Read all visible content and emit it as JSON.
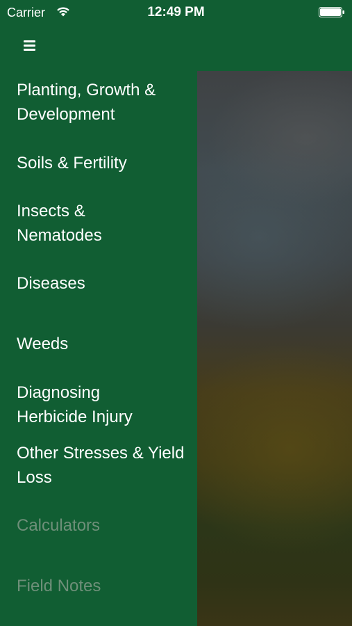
{
  "status_bar": {
    "carrier": "Carrier",
    "time": "12:49 PM",
    "wifi_icon": "wifi-icon",
    "battery_icon": "battery-icon"
  },
  "nav": {
    "menu_icon": "hamburger-menu-icon"
  },
  "menu": {
    "items": [
      {
        "label": "Planting, Growth & Development",
        "enabled": true
      },
      {
        "label": "Soils & Fertility",
        "enabled": true
      },
      {
        "label": "Insects & Nematodes",
        "enabled": true
      },
      {
        "label": "Diseases",
        "enabled": true
      },
      {
        "label": "Weeds",
        "enabled": true
      },
      {
        "label": "Diagnosing Herbicide Injury",
        "enabled": true
      },
      {
        "label": "Other Stresses & Yield Loss",
        "enabled": true
      },
      {
        "label": "Calculators",
        "enabled": false
      },
      {
        "label": "Field Notes",
        "enabled": false
      }
    ]
  },
  "colors": {
    "brand_green": "#115e33",
    "text": "#ffffff",
    "disabled_text": "#6e8f79"
  }
}
